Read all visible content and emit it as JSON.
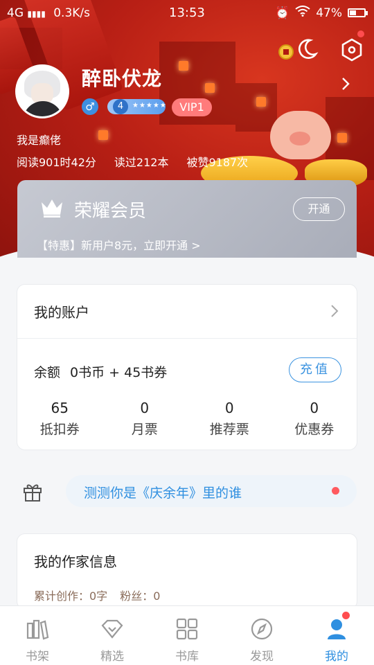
{
  "status_bar": {
    "network": "4G",
    "speed": "0.3K/s",
    "time": "13:53",
    "battery": "47%",
    "battery_level": 0.47
  },
  "profile": {
    "username": "醉卧伏龙",
    "level": "4",
    "vip_label": "VIP1",
    "signature": "我是癫佬",
    "stats": {
      "reading_time": "阅读901时42分",
      "books_read": "读过212本",
      "likes": "被赞9187次"
    }
  },
  "vip_card": {
    "title": "荣耀会员",
    "open_button": "开通",
    "promo": "【特惠】新用户8元，立即开通 >"
  },
  "account": {
    "title": "我的账户",
    "balance_label": "余额",
    "balance_value": "0书币 + 45书券",
    "recharge_button": "充值",
    "tickets": [
      {
        "value": "65",
        "label": "抵扣券"
      },
      {
        "value": "0",
        "label": "月票"
      },
      {
        "value": "0",
        "label": "推荐票"
      },
      {
        "value": "0",
        "label": "优惠券"
      }
    ]
  },
  "promo_strip": {
    "text": "测测你是《庆余年》里的谁"
  },
  "author": {
    "title": "我的作家信息",
    "total_words": "累计创作：0字",
    "fans": "粉丝：0"
  },
  "bottom_nav": [
    {
      "label": "书架",
      "icon": "bookshelf-icon"
    },
    {
      "label": "精选",
      "icon": "diamond-icon"
    },
    {
      "label": "书库",
      "icon": "grid-icon"
    },
    {
      "label": "发现",
      "icon": "compass-icon"
    },
    {
      "label": "我的",
      "icon": "user-icon",
      "active": true
    }
  ],
  "colors": {
    "accent": "#2f8fe0",
    "hero_red": "#b81f15",
    "badge_red": "#ff4d4f"
  }
}
